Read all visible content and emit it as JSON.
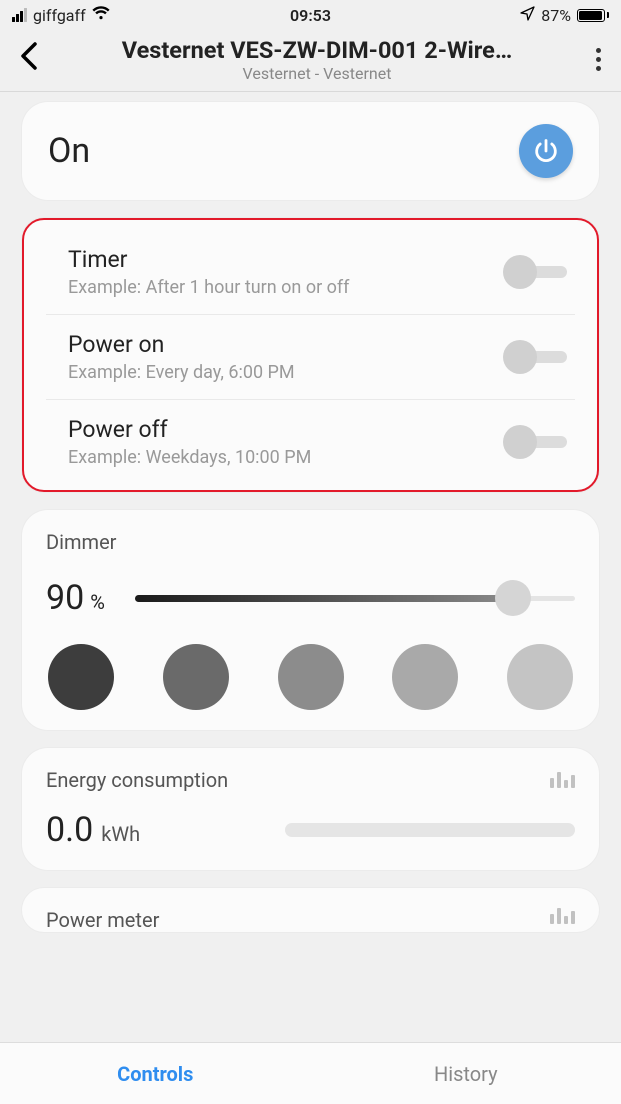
{
  "status": {
    "carrier": "giffgaff",
    "time": "09:53",
    "battery_pct": "87%"
  },
  "header": {
    "title": "Vesternet VES-ZW-DIM-001 2-Wire…",
    "subtitle": "Vesternet - Vesternet"
  },
  "on_card": {
    "state": "On"
  },
  "schedule": {
    "timer": {
      "title": "Timer",
      "sub": "Example: After 1 hour turn on or off"
    },
    "power_on": {
      "title": "Power on",
      "sub": "Example: Every day, 6:00 PM"
    },
    "power_off": {
      "title": "Power off",
      "sub": "Example: Weekdays, 10:00 PM"
    }
  },
  "dimmer": {
    "label": "Dimmer",
    "value": "90",
    "unit": "%",
    "swatch_colors": [
      "#3d3d3d",
      "#6a6a6a",
      "#8c8c8c",
      "#a9a9a9",
      "#c4c4c4"
    ]
  },
  "energy": {
    "label": "Energy consumption",
    "value": "0.0",
    "unit": "kWh"
  },
  "power_meter": {
    "label": "Power meter"
  },
  "tabs": {
    "controls": "Controls",
    "history": "History"
  }
}
